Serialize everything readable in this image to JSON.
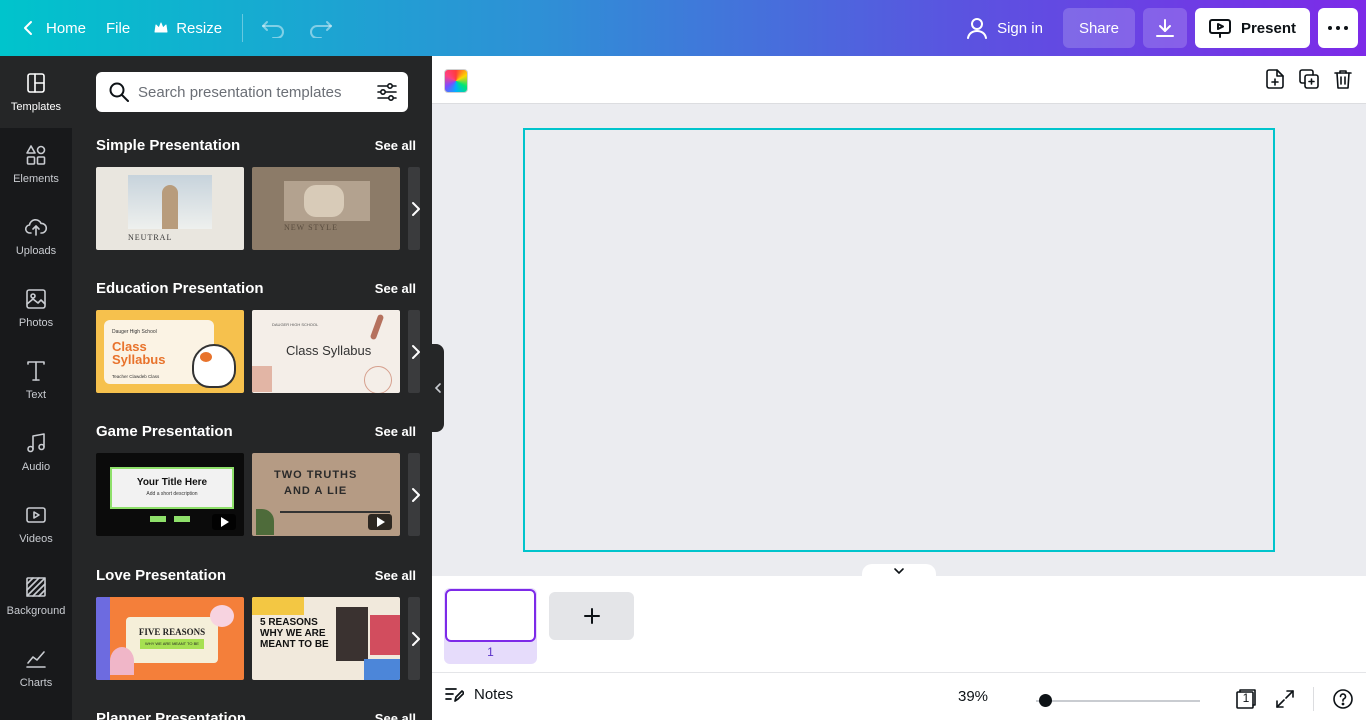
{
  "topbar": {
    "home_label": "Home",
    "file_label": "File",
    "resize_label": "Resize",
    "signin_label": "Sign in",
    "share_label": "Share",
    "present_label": "Present"
  },
  "rail": {
    "items": [
      {
        "label": "Templates",
        "icon": "templates-icon"
      },
      {
        "label": "Elements",
        "icon": "elements-icon"
      },
      {
        "label": "Uploads",
        "icon": "uploads-icon"
      },
      {
        "label": "Photos",
        "icon": "photos-icon"
      },
      {
        "label": "Text",
        "icon": "text-icon"
      },
      {
        "label": "Audio",
        "icon": "audio-icon"
      },
      {
        "label": "Videos",
        "icon": "videos-icon"
      },
      {
        "label": "Background",
        "icon": "background-icon"
      },
      {
        "label": "Charts",
        "icon": "charts-icon"
      }
    ]
  },
  "panel": {
    "search_placeholder": "Search presentation templates",
    "see_all_label": "See all",
    "sections": [
      {
        "title": "Simple Presentation",
        "thumb1_text": "NEUTRAL",
        "thumb2_text": "NEW STYLE"
      },
      {
        "title": "Education Presentation",
        "thumb1_school": "Dauger High School",
        "thumb1_title1": "Class",
        "thumb1_title2": "Syllabus",
        "thumb1_sub": "Teacher Clawdeb Class",
        "thumb2_school": "DAUGER HIGH SCHOOL",
        "thumb2_title": "Class Syllabus"
      },
      {
        "title": "Game Presentation",
        "thumb1_title": "Your Title Here",
        "thumb1_sub": "Add a short description",
        "thumb2_title1": "TWO TRUTHS",
        "thumb2_title2": "AND A LIE"
      },
      {
        "title": "Love Presentation",
        "thumb1_title": "FIVE REASONS",
        "thumb1_sub": "WHY WE ARE MEANT TO BE",
        "thumb2_title1": "5 REASONS",
        "thumb2_title2": "WHY WE ARE",
        "thumb2_title3": "MEANT TO BE"
      },
      {
        "title": "Planner Presentation"
      }
    ]
  },
  "pages": {
    "current_page": "1"
  },
  "footer": {
    "notes_label": "Notes",
    "zoom": "39%",
    "page_count": "1"
  },
  "colors": {
    "accent": "#7d2ae8",
    "selection": "#00c4cc",
    "rail_bg": "#18191b",
    "panel_bg": "#252627"
  }
}
